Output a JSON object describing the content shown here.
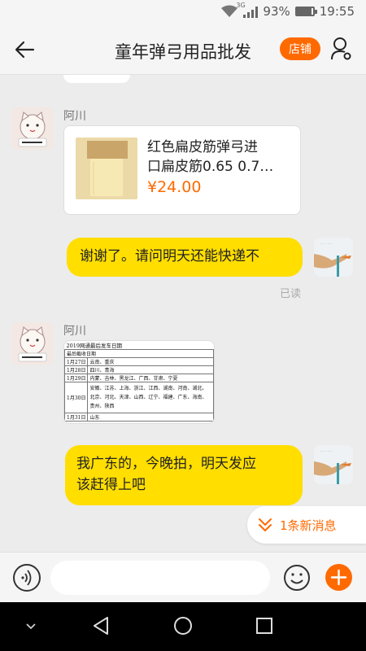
{
  "status_bar": {
    "network_label": "3G",
    "battery_percent": "93%",
    "battery_level": 0.93,
    "time": "19:55"
  },
  "header": {
    "title": "童年弹弓用品批发",
    "shop_button": "店铺"
  },
  "messages": {
    "sender_name_1": "阿川",
    "product": {
      "name_line1": "红色扁皮筋弹弓进",
      "name_line2": "口扁皮筋0.65 0.7…",
      "price": "¥24.00"
    },
    "my_message_1": "谢谢了。请问明天还能快递不",
    "read_label": "已读",
    "sender_name_2": "阿川",
    "image_table": {
      "title": "2019网通最后发车日期",
      "subtitle": "最后截收日期",
      "rows": [
        {
          "date": "1月27日",
          "regions": "云南、重庆"
        },
        {
          "date": "1月28日",
          "regions": "四川、青海"
        },
        {
          "date": "1月29日",
          "regions": "内蒙、吉林、黑龙江、广西、甘肃、宁夏"
        },
        {
          "date": "1月30日",
          "regions": "安徽、江苏、上海、浙江、江西、湖南、河南、湖北、北京、河北、天津、山西、辽宁、福建、广东、海南、贵州、陕西"
        },
        {
          "date": "1月31日",
          "regions": "山东"
        }
      ]
    },
    "my_message_2_line1": "我广东的，今晚拍，明天发应",
    "my_message_2_line2": "该赶得上吧"
  },
  "new_message_banner": "1条新消息",
  "input": {
    "placeholder": ""
  },
  "colors": {
    "accent": "#ff6a00",
    "my_bubble": "#ffde00",
    "background": "#ececec"
  },
  "icons": [
    "back-arrow-icon",
    "user-settings-icon",
    "voice-icon",
    "emoji-icon",
    "plus-icon",
    "nav-back-icon",
    "nav-home-icon",
    "nav-recents-icon",
    "double-chevron-down-icon",
    "wifi-icon",
    "signal-icon",
    "battery-icon"
  ]
}
